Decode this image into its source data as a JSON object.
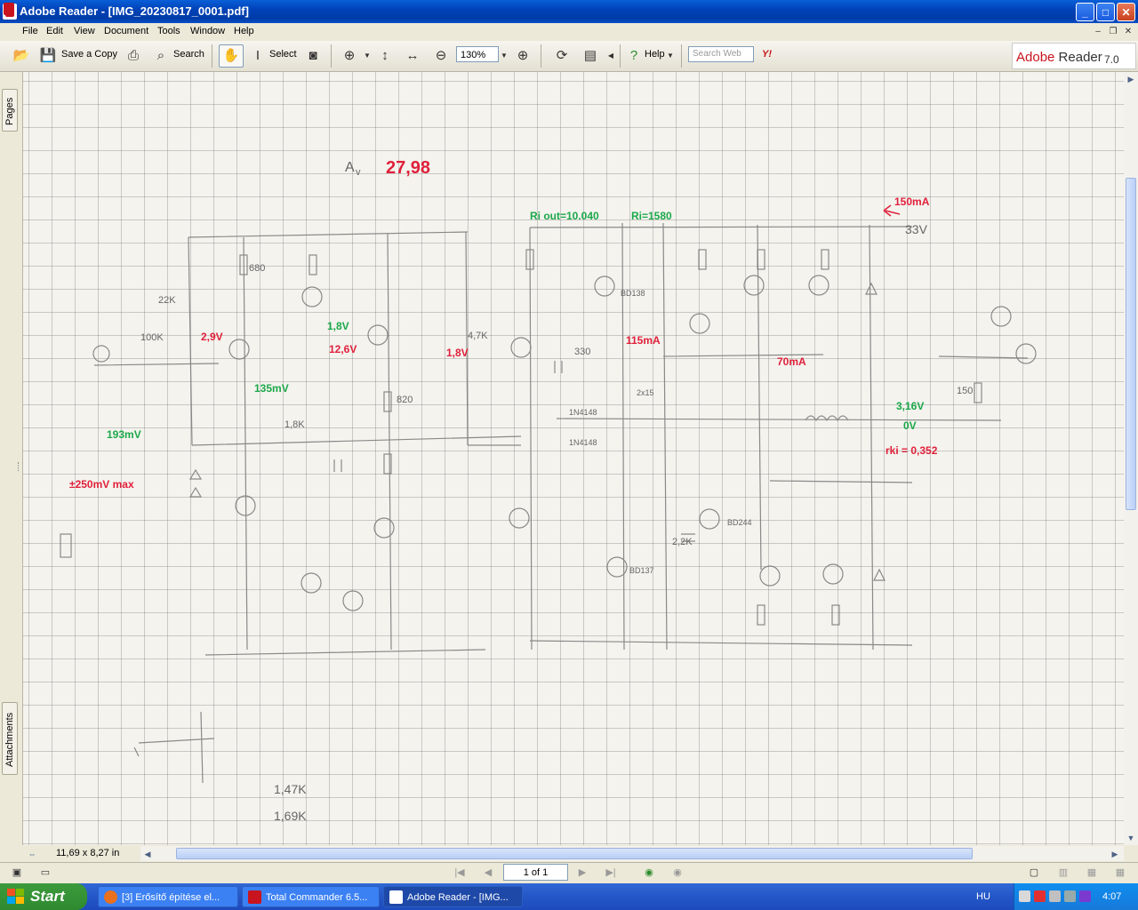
{
  "window": {
    "title": "Adobe Reader - [IMG_20230817_0001.pdf]",
    "controls": {
      "minimize": "_",
      "maximize": "□",
      "close": "✕"
    }
  },
  "menu": {
    "items": [
      "File",
      "Edit",
      "View",
      "Document",
      "Tools",
      "Window",
      "Help"
    ]
  },
  "toolbar": {
    "save_copy_label": "Save a Copy",
    "search_label": "Search",
    "select_label": "Select",
    "zoom_value": "130%",
    "help_label": "Help",
    "search_web_placeholder": "Search Web",
    "yahoo_label": "Y!",
    "adobe_brand": "Adobe",
    "adobe_product": "Reader",
    "adobe_version": "7.0"
  },
  "side_tabs": {
    "pages": "Pages",
    "attachments": "Attachments"
  },
  "document": {
    "page_size": "11,69 x 8,27 in",
    "annotations": {
      "gain_label": "A",
      "gain_sub": "v",
      "gain_value": "27,98",
      "current_top_right": "150mA",
      "supply_voltage": "33V",
      "ri_out": "Ri out=10.040",
      "ri": "Ri=1580",
      "input_amp": "±250mV max",
      "v_red_1": "2,9V",
      "v_red_2": "12,6V",
      "v_red_3": "1,8V",
      "i_red_1": "115mA",
      "i_red_2": "70mA",
      "v_green_1": "1,8V",
      "v_green_2": "135mV",
      "v_green_3": "193mV",
      "v_green_4": "3,16V",
      "v_green_5": "0V",
      "r_out": "rki = 0,352",
      "r_1": "22K",
      "r_2": "680",
      "r_3": "100K",
      "r_4": "1,8K",
      "r_5": "820",
      "r_6": "330",
      "r_7": "4,7K",
      "r_8": "150",
      "r_9": "2,2K",
      "r_10": "1,47K",
      "r_11": "1,69K",
      "t_1": "BD138",
      "t_2": "BD137",
      "t_3": "BD244",
      "d_1": "1N4148",
      "d_2": "1N4148",
      "l_1": "2x15"
    }
  },
  "nav": {
    "page_indicator": "1 of 1"
  },
  "taskbar": {
    "start_label": "Start",
    "tasks": [
      {
        "label": "[3] Erősítő építése el...",
        "active": false
      },
      {
        "label": "Total Commander 6.5...",
        "active": false
      },
      {
        "label": "Adobe Reader - [IMG...",
        "active": true
      }
    ],
    "language": "HU",
    "clock": "4:07"
  }
}
